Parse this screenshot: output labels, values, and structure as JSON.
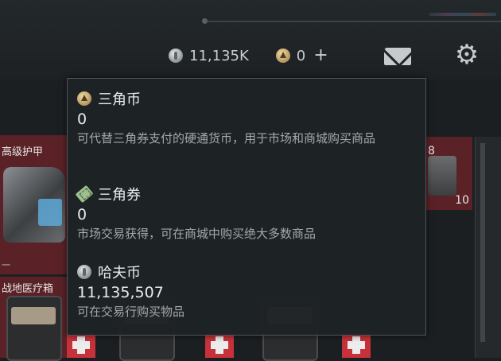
{
  "topbar": {
    "hafu_display": "11,135K",
    "triangle_coin_display": "0",
    "plus_label": "+",
    "icons": {
      "hafu": "silver-coin-icon",
      "triangle": "gold-triangle-coin-icon",
      "mail": "mail-icon",
      "settings": "gear-icon"
    }
  },
  "inventory": {
    "armor_title": "高级护甲",
    "armor_mark": "一",
    "medkit_title": "战地医疗箱",
    "case_count_top": "8",
    "case_count_bottom": "10"
  },
  "tooltip": {
    "sections": [
      {
        "icon": "triangle-coin-icon",
        "title": "三角币",
        "value": "0",
        "description": "可代替三角券支付的硬通货币，用于市场和商城购买商品"
      },
      {
        "icon": "triangle-ticket-icon",
        "title": "三角券",
        "value": "0",
        "description": "市场交易获得，可在商城中购买绝大多数商品"
      },
      {
        "icon": "hafu-coin-icon",
        "title": "哈夫币",
        "value": "11,135,507",
        "description": "可在交易行购买物品"
      }
    ]
  },
  "colors": {
    "background": "#1b1f22",
    "tooltip_bg": "#1e2225",
    "item_red": "#5a2226",
    "text_primary": "#e9eaeb",
    "text_secondary": "#a4a8ab"
  }
}
